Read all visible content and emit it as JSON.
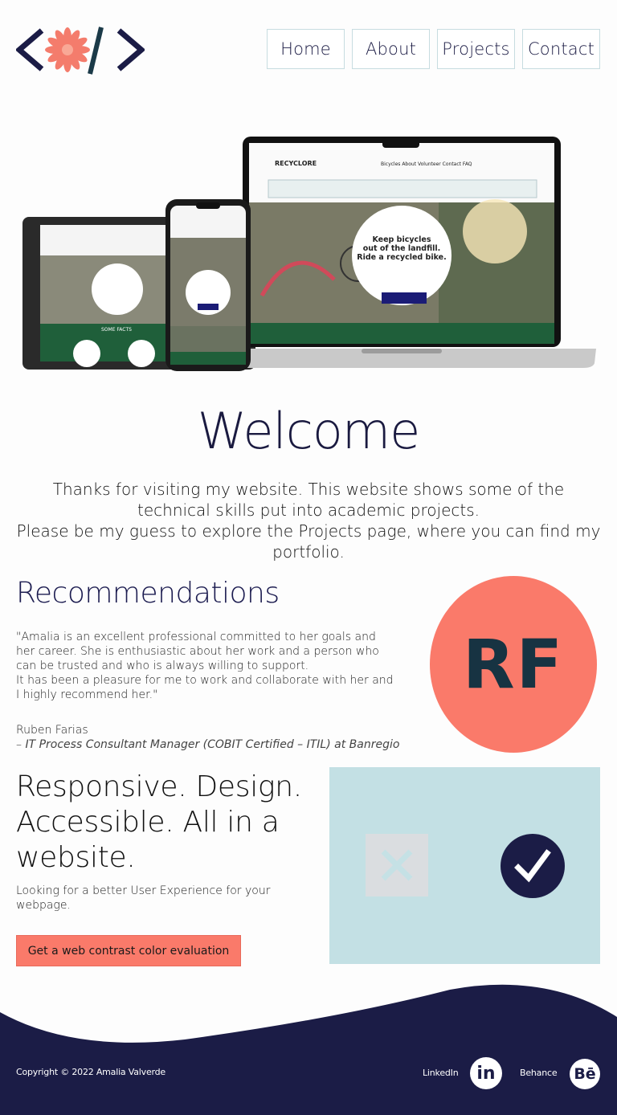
{
  "nav": {
    "items": [
      {
        "label": "Home"
      },
      {
        "label": "About"
      },
      {
        "label": "Projects"
      },
      {
        "label": "Contact"
      }
    ]
  },
  "hero": {
    "icon": "device-mockup-image",
    "site_name": "RECYCLORE",
    "headline": "Keep bicycles out of the landfill. Ride a recycled bike.",
    "facts_label": "SOME FACTS"
  },
  "welcome": {
    "title": "Welcome",
    "line1": "Thanks for visiting my website. This website shows some of the technical skills put into academic projects.",
    "line2": "Please be my guess to explore the Projects page, where you can find my portfolio."
  },
  "recommendations": {
    "title": "Recommendations",
    "quote_p1": "\"Amalia is an excellent professional committed to her goals and her career. She is enthusiastic about her work and a person who can be trusted and who is always willing to support.",
    "quote_p2": "It has been a pleasure for me to work and collaborate with her and I highly recommend her.\"",
    "author": "Ruben Farias",
    "role_prefix": "– ",
    "role": "IT Process Consultant Manager (COBIT Certified – ITIL) at Banregio",
    "avatar_initials": "RF",
    "avatar_color": "#fa7a6a"
  },
  "responsive": {
    "title": "Responsive. Design. Accessible. All in a website.",
    "subtitle": "Looking for a better User Experience for your webpage.",
    "cta_label": "Get a web contrast color evaluation",
    "cta_color": "#fa7a6a",
    "box_color": "#c3e0e4"
  },
  "footer": {
    "copyright": "Copyright © 2022 Amalia Valverde",
    "linkedin_label": "LinkedIn",
    "linkedin_icon_text": "in",
    "behance_label": "Behance",
    "behance_icon_text": "Bē",
    "bg_color": "#1b1c46"
  }
}
